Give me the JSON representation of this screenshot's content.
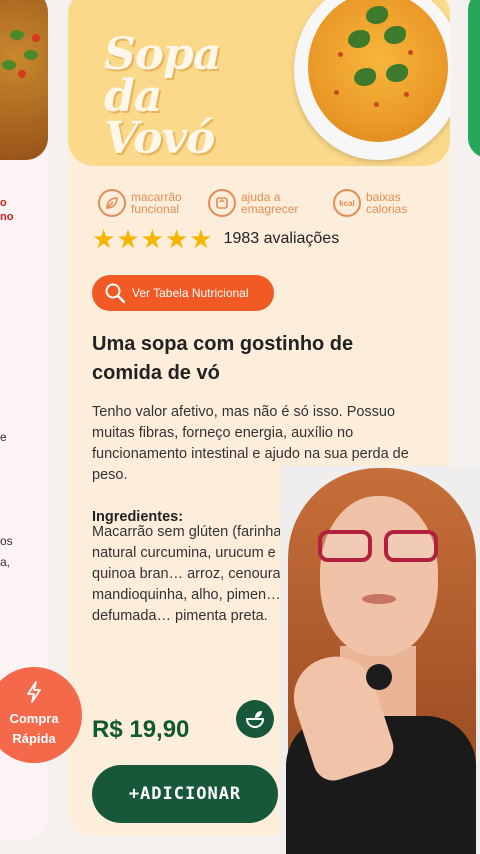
{
  "left_card": {
    "red_text_1": "o",
    "red_text_2": "no",
    "text_e": "e",
    "text_os": "os",
    "text_a": "a,"
  },
  "product": {
    "title_logo_line1": "Sopa da",
    "title_logo_line2": "Vovó",
    "features": [
      {
        "icon": "leaf-icon",
        "label": "macarrão funcional"
      },
      {
        "icon": "weight-icon",
        "label": "ajuda a emagrecer"
      },
      {
        "icon": "kcal-icon",
        "icon_text": "kcal",
        "label": "baixas calorias"
      }
    ],
    "rating": {
      "stars": 5,
      "count_label": "1983 avaliações"
    },
    "nutrition_button": "Ver Tabela Nutricional",
    "headline": "Uma sopa com gostinho de comida de vó",
    "description": "Tenho valor afetivo, mas não é só isso. Possuo muitas fibras, forneço energia, auxílio no funcionamento intestinal e ajudo na sua perda de peso.",
    "ingredients_title": "Ingredientes:",
    "ingredients": "Macarrão sem glúten (farinha de arroz e corante natural curcumina, urucum e e… flocos de batata, quinoa bran… arroz, cenoura, cebola, tom… mandioquinha, alho, pimen… cúrcuma, páprica defumada… pimenta preta.",
    "price": "R$ 19,90",
    "add_button": "+ADICIONAR"
  },
  "quick_buy": {
    "label_line1": "Compra",
    "label_line2": "Rápida"
  },
  "colors": {
    "card_bg": "#fdeedb",
    "hero_bg": "#fbd98a",
    "accent_orange": "#f15a24",
    "feature_orange": "#e38d54",
    "brand_green": "#17583a",
    "price_green": "#10582f",
    "star": "#f7b500"
  }
}
